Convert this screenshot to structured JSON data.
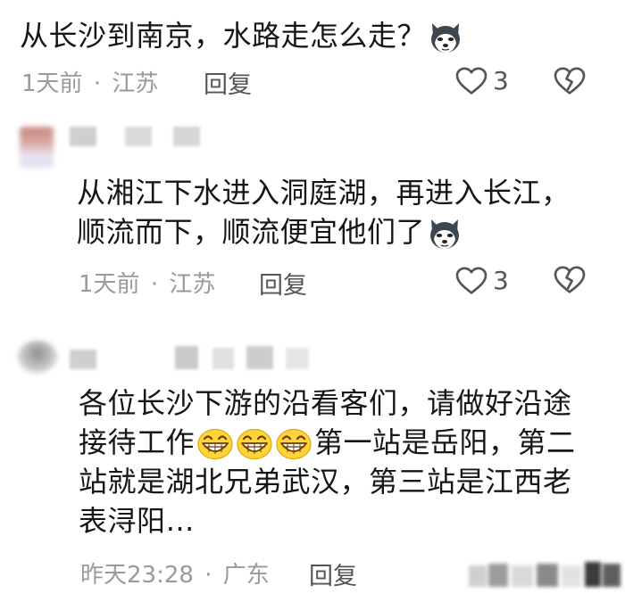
{
  "comments": [
    {
      "lines": [
        "从长沙到南京，水路走怎么走？"
      ],
      "time": "1天前",
      "sep": "·",
      "location": "江苏",
      "reply": "回复",
      "likes": "3",
      "emoji": "husky-icon"
    },
    {
      "lines": [
        "从湘江下水进入洞庭湖，再进入长江，",
        "顺流而下，顺流便宜他们了"
      ],
      "time": "1天前",
      "sep": "·",
      "location": "江苏",
      "reply": "回复",
      "likes": "3",
      "emoji": "husky-icon"
    },
    {
      "lines": [
        "各位长沙下游的沿看客们，请做好沿途",
        "接待工作",
        "第一站是岳阳，第二",
        "站就是湖北兄弟武汉，第三站是江西老",
        "表浔阳…"
      ],
      "time": "昨天23:28",
      "sep": "·",
      "location": "广东",
      "reply": "回复",
      "emoji": "grinning-icon"
    }
  ],
  "colors": {
    "text": "#161616",
    "meta": "#9a9a9a",
    "icon": "#555555"
  }
}
